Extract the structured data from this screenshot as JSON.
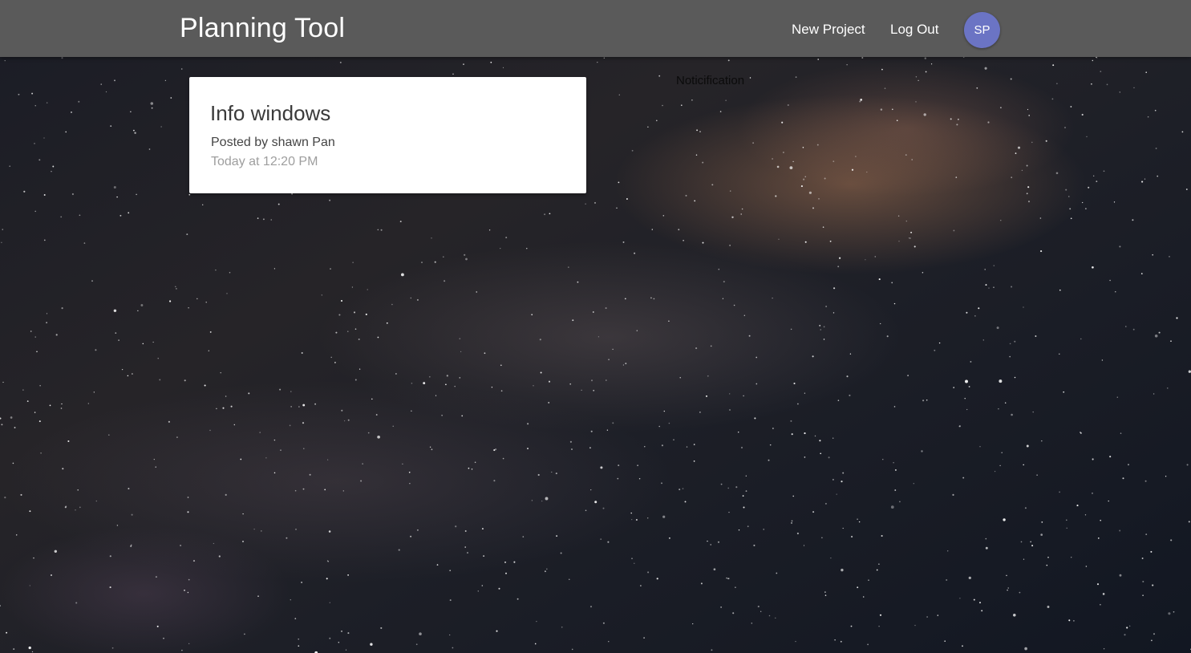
{
  "navbar": {
    "brand": "Planning Tool",
    "links": {
      "new_project": "New Project",
      "log_out": "Log Out"
    },
    "avatar_initials": "SP",
    "avatar_color": "#6b74c4",
    "bar_color": "#5a5a5a"
  },
  "projects": [
    {
      "title": "Info windows",
      "author_line": "Posted by shawn Pan",
      "time": "Today at 12:20 PM"
    }
  ],
  "notifications": {
    "heading": "Noticification"
  },
  "background": {
    "description_icon": "milky-way-background"
  }
}
